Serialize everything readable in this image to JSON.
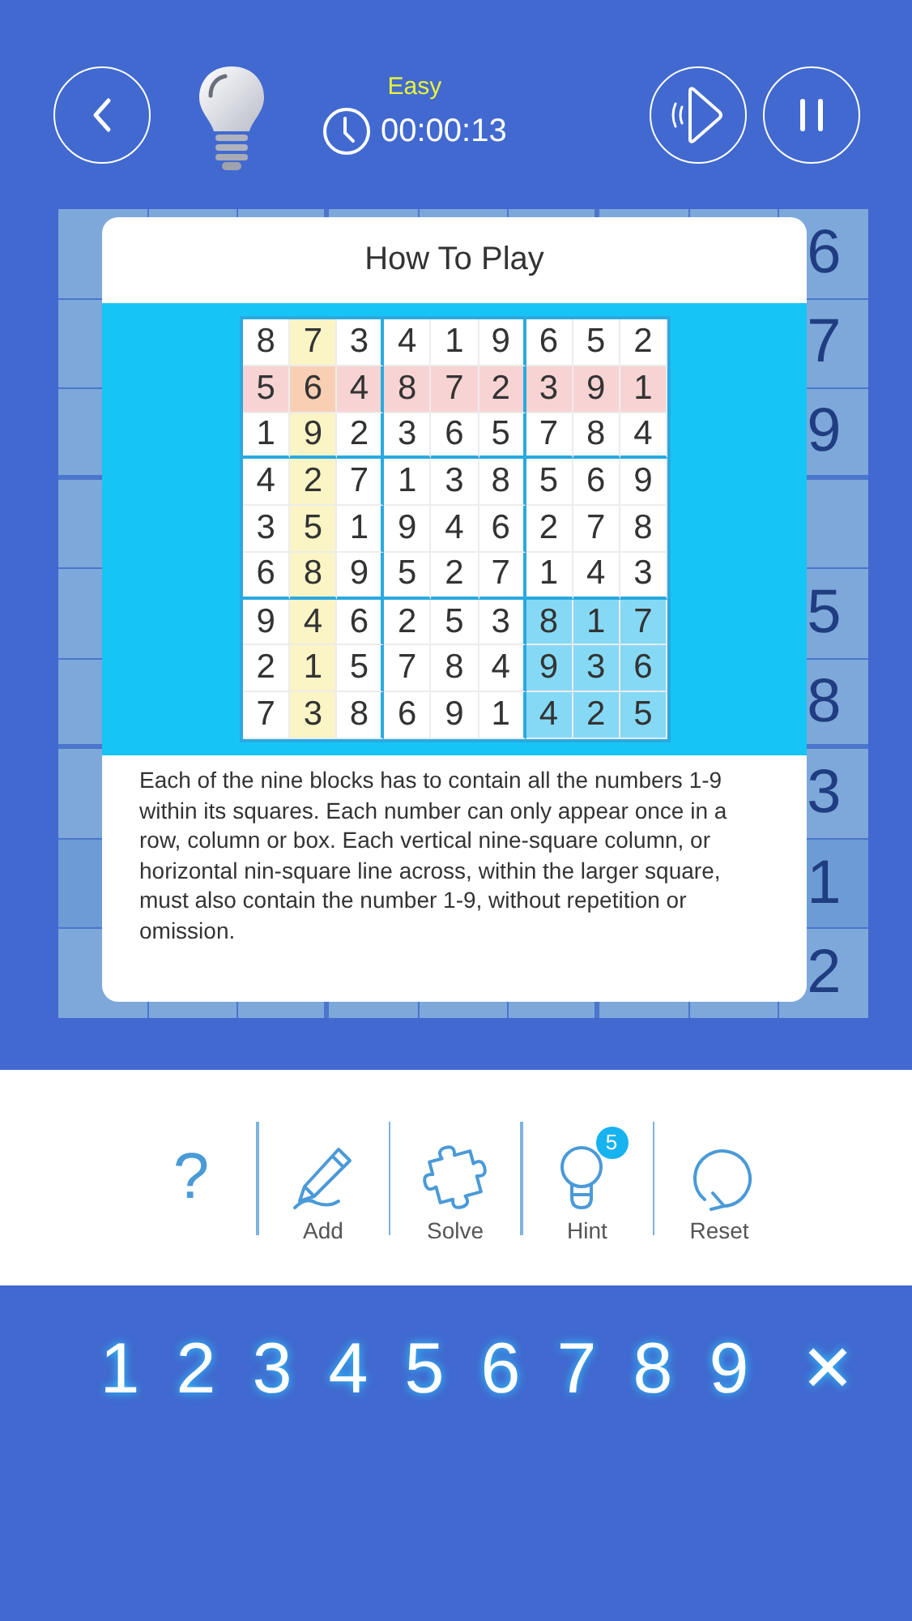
{
  "header": {
    "difficulty": "Easy",
    "timer": "00:00:13"
  },
  "board": {
    "rows": [
      {
        "right_cell": "6",
        "selected": false
      },
      {
        "right_cell": "7",
        "selected": false
      },
      {
        "right_cell": "9",
        "selected": false
      },
      {
        "selected": false
      },
      {
        "right_cell": "5",
        "selected": false
      },
      {
        "right_cell": "8",
        "selected": false
      },
      {
        "right_cell": "3",
        "selected": false
      },
      {
        "right_cell": "1",
        "selected": true
      },
      {
        "right_cell": "2",
        "selected": false
      }
    ]
  },
  "dialog": {
    "title": "How To Play",
    "grid": {
      "rows": [
        {
          "digits": [
            "8",
            "7",
            "3",
            "4",
            "1",
            "9",
            "6",
            "5",
            "2"
          ],
          "highlighted": false
        },
        {
          "digits": [
            "5",
            "6",
            "4",
            "8",
            "7",
            "2",
            "3",
            "9",
            "1"
          ],
          "highlighted": true
        },
        {
          "digits": [
            "1",
            "9",
            "2",
            "3",
            "6",
            "5",
            "7",
            "8",
            "4"
          ],
          "highlighted": false
        },
        {
          "digits": [
            "4",
            "2",
            "7",
            "1",
            "3",
            "8",
            "5",
            "6",
            "9"
          ],
          "highlighted": false
        },
        {
          "digits": [
            "3",
            "5",
            "1",
            "9",
            "4",
            "6",
            "2",
            "7",
            "8"
          ],
          "highlighted": false
        },
        {
          "digits": [
            "6",
            "8",
            "9",
            "5",
            "2",
            "7",
            "1",
            "4",
            "3"
          ],
          "highlighted": false
        },
        {
          "digits": [
            "9",
            "4",
            "6",
            "2",
            "5",
            "3",
            "8",
            "1",
            "7"
          ],
          "highlighted": false
        },
        {
          "digits": [
            "2",
            "1",
            "5",
            "7",
            "8",
            "4",
            "9",
            "3",
            "6"
          ],
          "highlighted": false
        },
        {
          "digits": [
            "7",
            "3",
            "8",
            "6",
            "9",
            "1",
            "4",
            "2",
            "5"
          ],
          "highlighted": false
        }
      ],
      "columns_highlighted": [
        false,
        true,
        false,
        false,
        false,
        false,
        false,
        false,
        false
      ],
      "blocks_highlighted": [
        false,
        false,
        false,
        false,
        false,
        false,
        false,
        false,
        true
      ]
    },
    "text": "Each of the nine blocks has to contain all the numbers 1-9 within its squares. Each number can only appear once in a row, column or box. Each vertical nine-square column, or horizontal nin-square line across, within the larger square, must also contain the number 1-9, without repetition or omission."
  },
  "toolbar": [
    {
      "kind": "help",
      "symbol": "?"
    },
    {
      "kind": "add",
      "label": "Add"
    },
    {
      "kind": "solve",
      "label": "Solve"
    },
    {
      "kind": "hint",
      "label": "Hint",
      "badge": "5"
    },
    {
      "kind": "reset",
      "label": "Reset"
    }
  ],
  "keypad": [
    {
      "kind": "digit",
      "label": "1"
    },
    {
      "kind": "digit",
      "label": "2"
    },
    {
      "kind": "digit",
      "label": "3"
    },
    {
      "kind": "digit",
      "label": "4"
    },
    {
      "kind": "digit",
      "label": "5"
    },
    {
      "kind": "digit",
      "label": "6"
    },
    {
      "kind": "digit",
      "label": "7"
    },
    {
      "kind": "digit",
      "label": "8"
    },
    {
      "kind": "digit",
      "label": "9"
    },
    {
      "kind": "erase",
      "label": "✕"
    }
  ]
}
